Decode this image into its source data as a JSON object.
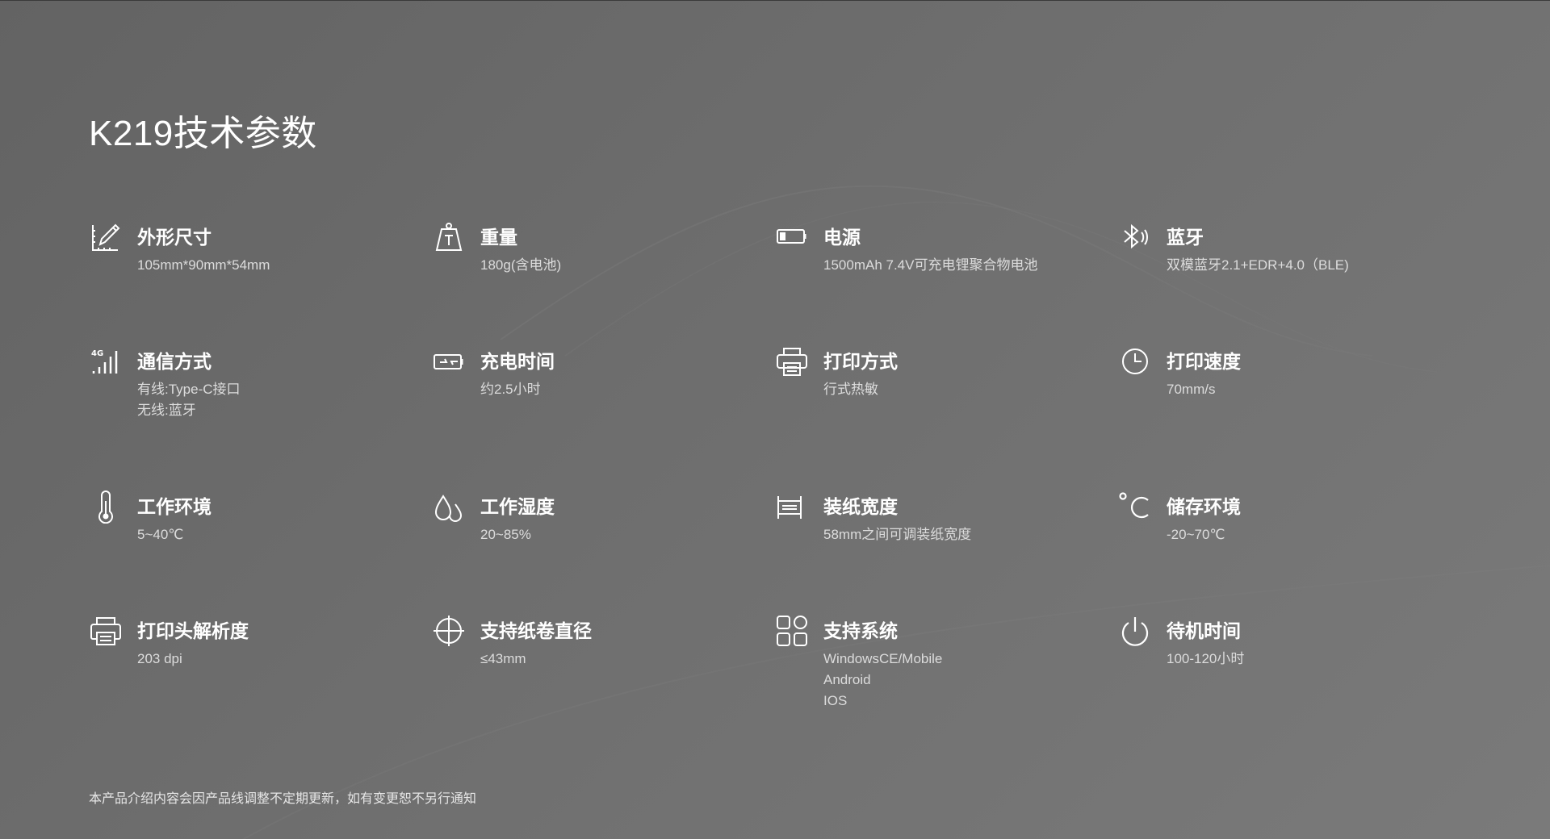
{
  "title": "K219技术参数",
  "footer_note": "本产品介绍内容会因产品线调整不定期更新，如有变更恕不另行通知",
  "specs": [
    {
      "label": "外形尺寸",
      "icon": "dimensions-icon",
      "values": [
        "105mm*90mm*54mm"
      ]
    },
    {
      "label": "重量",
      "icon": "weight-icon",
      "values": [
        "180g(含电池)"
      ]
    },
    {
      "label": "电源",
      "icon": "battery-icon",
      "values": [
        "1500mAh 7.4V可充电锂聚合物电池"
      ]
    },
    {
      "label": "蓝牙",
      "icon": "bluetooth-icon",
      "values": [
        "双模蓝牙2.1+EDR+4.0（BLE)"
      ]
    },
    {
      "label": "通信方式",
      "icon": "signal-4g-icon",
      "values": [
        "有线:Type-C接口",
        "无线:蓝牙"
      ]
    },
    {
      "label": "充电时间",
      "icon": "charging-battery-icon",
      "values": [
        "约2.5小时"
      ]
    },
    {
      "label": "打印方式",
      "icon": "printer-icon",
      "values": [
        "行式热敏"
      ]
    },
    {
      "label": "打印速度",
      "icon": "clock-icon",
      "values": [
        "70mm/s"
      ]
    },
    {
      "label": "工作环境",
      "icon": "thermometer-icon",
      "values": [
        "5~40℃"
      ]
    },
    {
      "label": "工作湿度",
      "icon": "humidity-drops-icon",
      "values": [
        "20~85%"
      ]
    },
    {
      "label": "装纸宽度",
      "icon": "paper-width-icon",
      "values": [
        "58mm之间可调装纸宽度"
      ]
    },
    {
      "label": "储存环境",
      "icon": "celsius-icon",
      "values": [
        "-20~70℃"
      ]
    },
    {
      "label": "打印头解析度",
      "icon": "print-head-icon",
      "values": [
        "203 dpi"
      ]
    },
    {
      "label": "支持纸卷直径",
      "icon": "crosshair-icon",
      "values": [
        "≤43mm"
      ]
    },
    {
      "label": "支持系统",
      "icon": "apps-grid-icon",
      "values": [
        "WindowsCE/Mobile",
        "Android",
        "IOS"
      ]
    },
    {
      "label": "待机时间",
      "icon": "power-icon",
      "values": [
        "100-120小时"
      ]
    }
  ]
}
